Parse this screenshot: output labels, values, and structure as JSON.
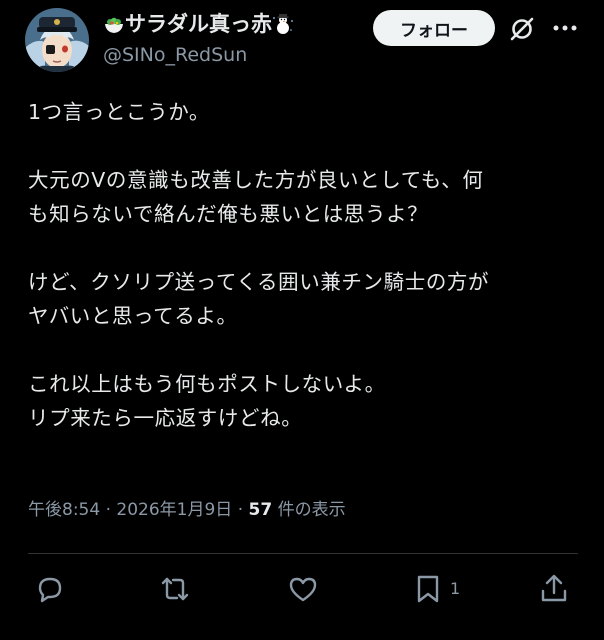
{
  "author": {
    "display_name": "サラダル真っ赤",
    "name_emoji_left": "salad-emoji",
    "name_emoji_right": "snowman-emoji",
    "handle": "@SINo_RedSun",
    "avatar": "anime-character-avatar"
  },
  "header": {
    "follow_label": "フォロー",
    "grok_icon": "grok-icon",
    "more_icon": "more-dots-icon"
  },
  "post": {
    "paragraphs": [
      {
        "lines": [
          "1つ言っとこうか。"
        ]
      },
      {
        "lines": [
          "大元のVの意識も改善した方が良いとしても、何",
          "も知らないで絡んだ俺も悪いとは思うよ？"
        ]
      },
      {
        "lines": [
          "けど、クソリプ送ってくる囲い兼チン騎士の方が",
          "ヤバいと思ってるよ。"
        ]
      },
      {
        "lines": [
          "これ以上はもう何もポストしないよ。",
          "リプ来たら一応返すけどね。"
        ]
      }
    ]
  },
  "meta": {
    "time": "午後8:54",
    "sep1": " · ",
    "date": "2026年1月9日",
    "sep2": " · ",
    "views_count": "57",
    "views_label": " 件の表示"
  },
  "actions": {
    "reply_icon": "reply-icon",
    "repost_icon": "repost-icon",
    "like_icon": "like-icon",
    "bookmark_icon": "bookmark-icon",
    "bookmark_count": "1",
    "share_icon": "share-icon"
  },
  "colors": {
    "background": "#000000",
    "text_primary": "#e7e9ea",
    "text_secondary": "#8b98a5",
    "divider": "#2f3336",
    "follow_button_bg": "#eff3f4",
    "follow_button_text": "#0f1419"
  }
}
